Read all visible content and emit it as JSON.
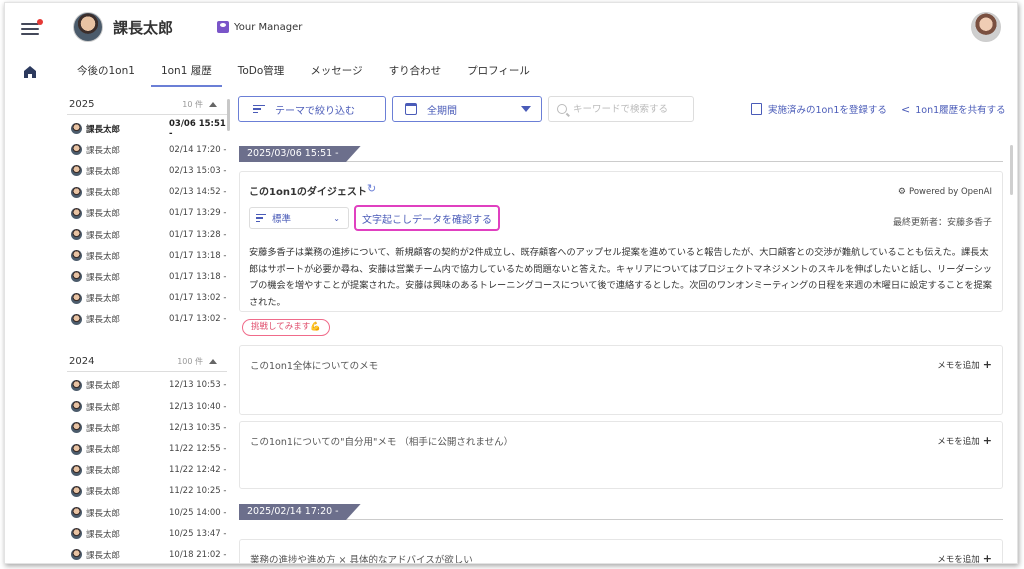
{
  "header": {
    "user_name": "課長太郎",
    "manager_label": "Your Manager"
  },
  "tabs": [
    {
      "label": "今後の1on1"
    },
    {
      "label": "1on1 履歴"
    },
    {
      "label": "ToDo管理"
    },
    {
      "label": "メッセージ"
    },
    {
      "label": "すり合わせ"
    },
    {
      "label": "プロフィール"
    }
  ],
  "history": {
    "y2025": {
      "year": "2025",
      "count": "10 件",
      "rows": [
        {
          "name": "課長太郎",
          "date": "03/06 15:51 -"
        },
        {
          "name": "課長太郎",
          "date": "02/14 17:20 -"
        },
        {
          "name": "課長太郎",
          "date": "02/13 15:03 -"
        },
        {
          "name": "課長太郎",
          "date": "02/13 14:52 -"
        },
        {
          "name": "課長太郎",
          "date": "01/17 13:29 -"
        },
        {
          "name": "課長太郎",
          "date": "01/17 13:28 -"
        },
        {
          "name": "課長太郎",
          "date": "01/17 13:18 -"
        },
        {
          "name": "課長太郎",
          "date": "01/17 13:18 -"
        },
        {
          "name": "課長太郎",
          "date": "01/17 13:02 -"
        },
        {
          "name": "課長太郎",
          "date": "01/17 13:02 -"
        }
      ]
    },
    "y2024": {
      "year": "2024",
      "count": "100 件",
      "rows": [
        {
          "name": "課長太郎",
          "date": "12/13 10:53 -"
        },
        {
          "name": "課長太郎",
          "date": "12/13 10:40 -"
        },
        {
          "name": "課長太郎",
          "date": "12/13 10:35 -"
        },
        {
          "name": "課長太郎",
          "date": "11/22 12:55 -"
        },
        {
          "name": "課長太郎",
          "date": "11/22 12:42 -"
        },
        {
          "name": "課長太郎",
          "date": "11/22 10:25 -"
        },
        {
          "name": "課長太郎",
          "date": "10/25 14:00 -"
        },
        {
          "name": "課長太郎",
          "date": "10/25 13:47 -"
        },
        {
          "name": "課長太郎",
          "date": "10/18 21:02 -"
        }
      ]
    }
  },
  "toolbar": {
    "filter_label": "テーマで絞り込む",
    "period_label": "全期間",
    "search_placeholder": "キーワードで検索する",
    "register_label": "実施済みの1on1を登録する",
    "share_label": "1on1履歴を共有する"
  },
  "session1": {
    "date_tag": "2025/03/06 15:51 -",
    "digest_title": "この1on1のダイジェスト",
    "powered_by": "Powered by OpenAI",
    "style_label": "標準",
    "transcript_label": "文字起こしデータを確認する",
    "updated_by": "最終更新者：安藤多香子",
    "digest_text": "安藤多香子は業務の進捗について、新規顧客の契約が2件成立し、既存顧客へのアップセル提案を進めていると報告したが、大口顧客との交渉が難航していることも伝えた。課長太郎はサポートが必要か尋ね、安藤は営業チーム内で協力しているため問題ないと答えた。キャリアについてはプロジェクトマネジメントのスキルを伸ばしたいと話し、リーダーシップの機会を増やすことが提案された。安藤は興味のあるトレーニングコースについて後で連絡するとした。次回のワンオンミーティングの日程を来週の木曜日に設定することを提案された。",
    "challenge_label": "挑戦してみます💪",
    "memo_public_title": "この1on1全体についてのメモ",
    "memo_private_title": "この1on1についての\"自分用\"メモ （相手に公開されません）",
    "memo_add_label": "メモを追加"
  },
  "session2": {
    "date_tag": "2025/02/14 17:20 -",
    "memo_title": "業務の進捗や進め方 × 具体的なアドバイスが欲しい",
    "memo_add_label": "メモを追加"
  }
}
